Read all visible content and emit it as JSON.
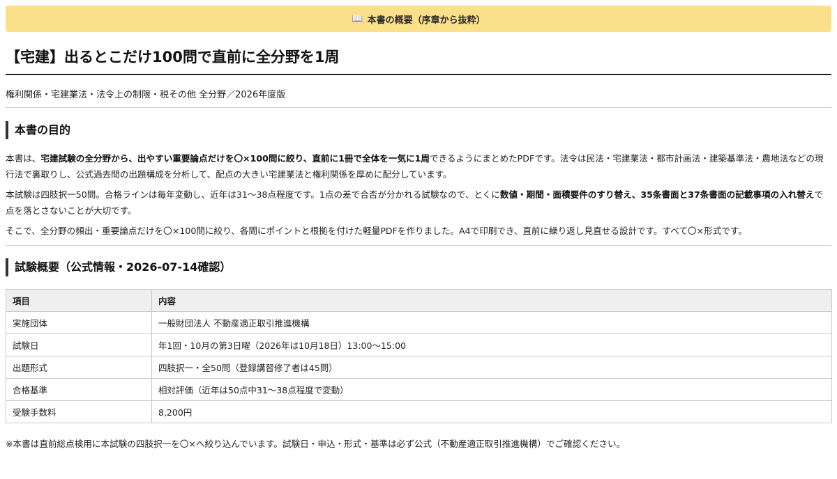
{
  "banner": {
    "icon": "book-icon",
    "text": "本書の概要（序章から抜粋）"
  },
  "title": "【宅建】出るとこだけ100問で直前に全分野を1周",
  "subtitle": "権利関係・宅建業法・法令上の制限・税その他 全分野／2026年度版",
  "purpose": {
    "heading": "本書の目的",
    "p1": {
      "pre": "本書は、",
      "bold": "宅建試験の全分野から、出やすい重要論点だけを〇×100問に絞り、直前に1冊で全体を一気に1周",
      "post": "できるようにまとめたPDFです。法令は民法・宅建業法・都市計画法・建築基準法・農地法などの現行法で裏取りし、公式過去問の出題構成を分析して、配点の大きい宅建業法と権利関係を厚めに配分しています。"
    },
    "p2": {
      "pre": "本試験は四肢択一50問。合格ラインは毎年変動し、近年は31〜38点程度です。1点の差で合否が分かれる試験なので、とくに",
      "bold": "数値・期間・面積要件のすり替え、35条書面と37条書面の記載事項の入れ替え",
      "post": "で点を落とさないことが大切です。"
    },
    "p3": "そこで、全分野の頻出・重要論点だけを〇×100問に絞り、各問にポイントと根拠を付けた軽量PDFを作りました。A4で印刷でき、直前に繰り返し見直せる設計です。すべて〇×形式です。"
  },
  "overview": {
    "heading": "試験概要（公式情報・2026-07-14確認）",
    "columns": [
      "項目",
      "内容"
    ],
    "rows": [
      [
        "実施団体",
        "一般財団法人 不動産適正取引推進機構"
      ],
      [
        "試験日",
        "年1回・10月の第3日曜（2026年は10月18日）13:00〜15:00"
      ],
      [
        "出題形式",
        "四肢択一・全50問（登録講習修了者は45問）"
      ],
      [
        "合格基準",
        "相対評価（近年は50点中31〜38点程度で変動）"
      ],
      [
        "受験手数料",
        "8,200円"
      ]
    ]
  },
  "note": "※本書は直前総点検用に本試験の四肢択一を〇×へ絞り込んでいます。試験日・申込・形式・基準は必ず公式（不動産適正取引推進機構）でご確認ください。",
  "colors": {
    "banner_bg": "#fbe08a",
    "heading_bar": "#333333",
    "table_header_bg": "#efefef"
  }
}
